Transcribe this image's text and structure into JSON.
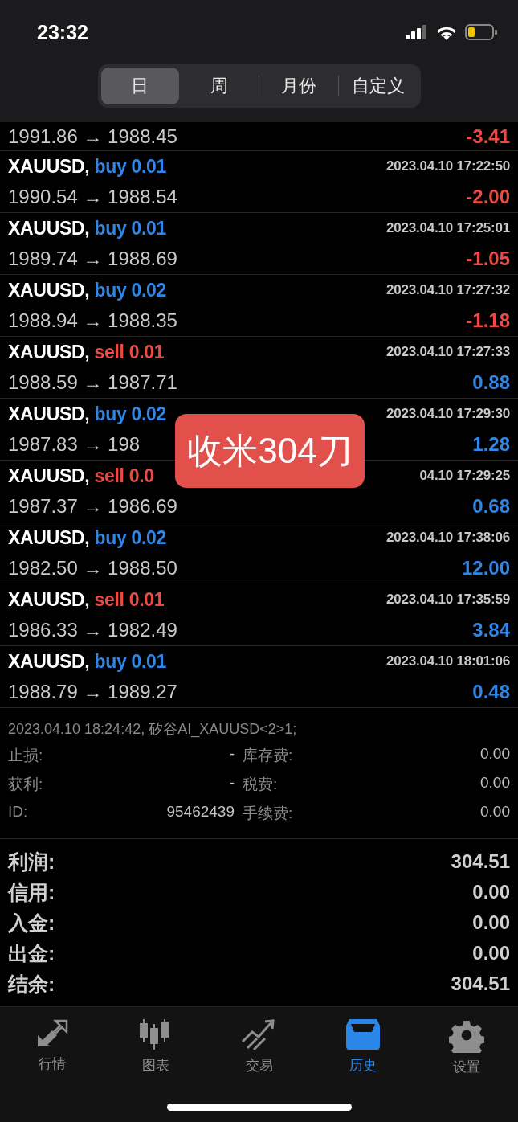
{
  "status_bar": {
    "time": "23:32"
  },
  "period_tabs": [
    {
      "label": "日",
      "selected": true
    },
    {
      "label": "周",
      "selected": false
    },
    {
      "label": "月份",
      "selected": false
    },
    {
      "label": "自定义",
      "selected": false
    }
  ],
  "deals": [
    {
      "kind": "partial",
      "price": "1991.86 → 1988.45",
      "profit": {
        "text": "-3.41",
        "color": "#ec4a43"
      }
    },
    {
      "kind": "full",
      "symbol": "XAUUSD,",
      "order": {
        "text": "buy 0.01",
        "color": "#2f86e6"
      },
      "time": "2023.04.10 17:22:50",
      "price": "1990.54 → 1988.54",
      "profit": {
        "text": "-2.00",
        "color": "#ec4a43"
      }
    },
    {
      "kind": "full",
      "symbol": "XAUUSD,",
      "order": {
        "text": "buy 0.01",
        "color": "#2f86e6"
      },
      "time": "2023.04.10 17:25:01",
      "price": "1989.74 → 1988.69",
      "profit": {
        "text": "-1.05",
        "color": "#ec4a43"
      }
    },
    {
      "kind": "full",
      "symbol": "XAUUSD,",
      "order": {
        "text": "buy 0.02",
        "color": "#2f86e6"
      },
      "time": "2023.04.10 17:27:32",
      "price": "1988.94 → 1988.35",
      "profit": {
        "text": "-1.18",
        "color": "#ec4a43"
      }
    },
    {
      "kind": "full",
      "symbol": "XAUUSD,",
      "order": {
        "text": "sell 0.01",
        "color": "#ec4a43"
      },
      "time": "2023.04.10 17:27:33",
      "price": "1988.59 → 1987.71",
      "profit": {
        "text": "0.88",
        "color": "#2f86e6"
      }
    },
    {
      "kind": "full",
      "symbol": "XAUUSD,",
      "order": {
        "text": "buy 0.02",
        "color": "#2f86e6"
      },
      "time": "2023.04.10 17:29:30",
      "price": "1987.83 → 198",
      "profit": {
        "text": "1.28",
        "color": "#2f86e6"
      }
    },
    {
      "kind": "full",
      "symbol": "XAUUSD,",
      "order": {
        "text": "sell 0.0",
        "color": "#ec4a43"
      },
      "time": "04.10 17:29:25",
      "price": "1987.37 → 1986.69",
      "profit": {
        "text": "0.68",
        "color": "#2f86e6"
      }
    },
    {
      "kind": "full",
      "symbol": "XAUUSD,",
      "order": {
        "text": "buy 0.02",
        "color": "#2f86e6"
      },
      "time": "2023.04.10 17:38:06",
      "price": "1982.50 → 1988.50",
      "profit": {
        "text": "12.00",
        "color": "#2f86e6"
      }
    },
    {
      "kind": "full",
      "symbol": "XAUUSD,",
      "order": {
        "text": "sell 0.01",
        "color": "#ec4a43"
      },
      "time": "2023.04.10 17:35:59",
      "price": "1986.33 → 1982.49",
      "profit": {
        "text": "3.84",
        "color": "#2f86e6"
      }
    },
    {
      "kind": "full",
      "symbol": "XAUUSD,",
      "order": {
        "text": "buy 0.01",
        "color": "#2f86e6"
      },
      "time": "2023.04.10 18:01:06",
      "price": "1988.79 → 1989.27",
      "profit": {
        "text": "0.48",
        "color": "#2f86e6"
      }
    }
  ],
  "caption_overlay": {
    "text": "收米304刀"
  },
  "comment": "2023.04.10 18:24:42, 矽谷AI_XAUUSD<2>1;",
  "details": [
    {
      "label": "止损:",
      "value": "-",
      "label_2": "库存费:",
      "value_2": "0.00"
    },
    {
      "label": "获利:",
      "value": "-",
      "label_2": "税费:",
      "value_2": "0.00"
    },
    {
      "label": "ID:",
      "value": "95462439",
      "label_2": "手续费:",
      "value_2": "0.00"
    }
  ],
  "summary": [
    {
      "label": "利润:",
      "value": "304.51"
    },
    {
      "label": "信用:",
      "value": "0.00"
    },
    {
      "label": "入金:",
      "value": "0.00"
    },
    {
      "label": "出金:",
      "value": "0.00"
    },
    {
      "label": "结余:",
      "value": "304.51"
    }
  ],
  "bottom_nav": [
    {
      "label": "行情",
      "kind": "arrows",
      "selected": false
    },
    {
      "label": "图表",
      "kind": "candles",
      "selected": false
    },
    {
      "label": "交易",
      "kind": "trend",
      "selected": false
    },
    {
      "label": "历史",
      "kind": "inbox",
      "selected": true
    },
    {
      "label": "设置",
      "kind": "gear",
      "selected": false
    }
  ]
}
